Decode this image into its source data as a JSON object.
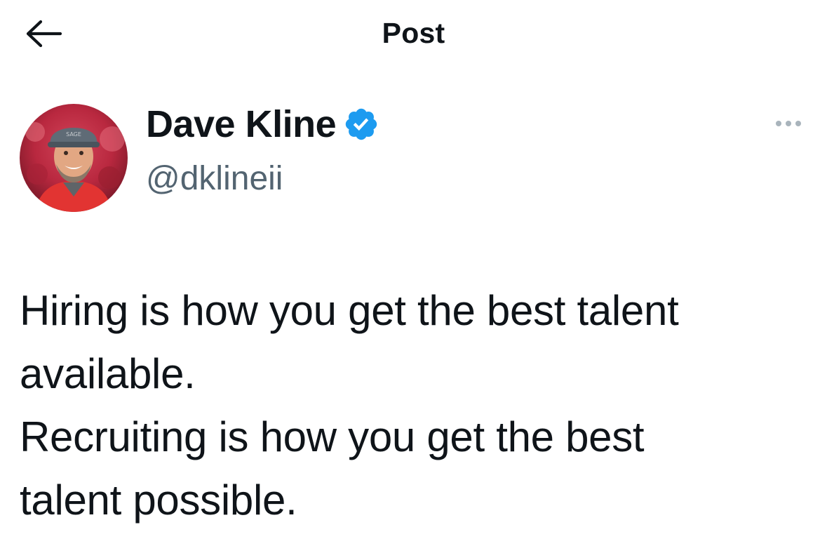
{
  "header": {
    "back_icon": "arrow-left-icon",
    "title": "Post"
  },
  "author": {
    "name": "Dave Kline",
    "handle": "@dklineii",
    "verified_icon": "verified-badge-icon",
    "avatar_icon": "profile-photo"
  },
  "more_icon": "more-options-icon",
  "post": {
    "lines": [
      "Hiring is how you get the best talent",
      "available.",
      "Recruiting is how you get the best",
      "talent possible."
    ]
  },
  "colors": {
    "text": "#0f1419",
    "secondary_text": "#536471",
    "verified_blue": "#1d9bf0",
    "background": "#ffffff"
  }
}
